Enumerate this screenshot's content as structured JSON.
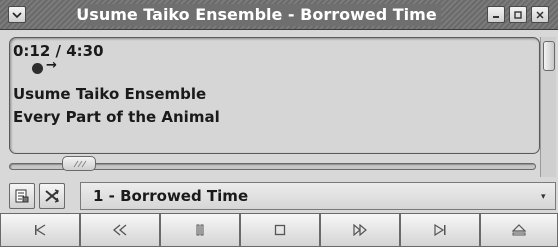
{
  "window": {
    "title": "Usume Taiko Ensemble - Borrowed Time",
    "menu_icon": "chevron-down-icon",
    "minimize_glyph": "–",
    "maximize_glyph": "□",
    "close_glyph": "×"
  },
  "display": {
    "time": "0:12 / 4:30",
    "state_icon": "record-dot-icon",
    "arrow_glyph": "→",
    "artist": "Usume Taiko Ensemble",
    "album": "Every Part of the Animal"
  },
  "seek": {
    "position_fraction": 0.1
  },
  "playlist": {
    "current_track": "1 - Borrowed Time",
    "dropdown_glyph": "▾"
  },
  "transport": {
    "prev": "⏮",
    "rewind": "⏪",
    "pause": "⏸",
    "stop": "◻",
    "forward": "⏩",
    "next": "⏭",
    "eject": "⏏"
  }
}
